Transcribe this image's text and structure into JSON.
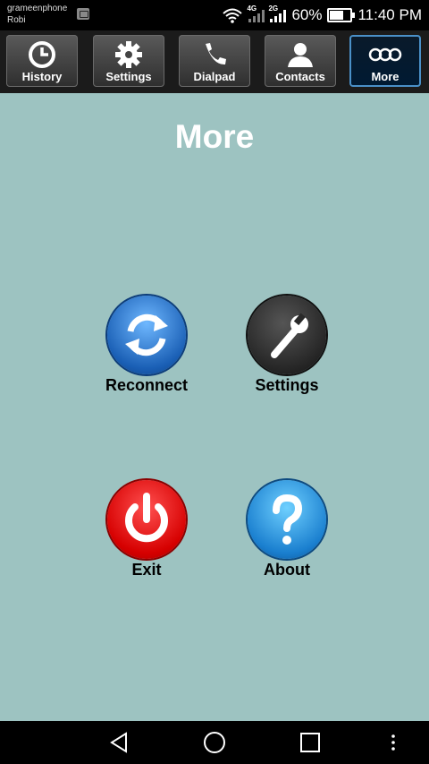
{
  "status_bar": {
    "carrier_primary": "grameenphone",
    "carrier_secondary": "Robi",
    "net1": "4G",
    "net2": "2G",
    "battery_percent": "60%",
    "battery_level": 0.6,
    "time": "11:40 PM"
  },
  "tabs": [
    {
      "label": "History",
      "icon": "clock-icon",
      "active": false
    },
    {
      "label": "Settings",
      "icon": "gear-icon",
      "active": false
    },
    {
      "label": "Dialpad",
      "icon": "phone-icon",
      "active": false
    },
    {
      "label": "Contacts",
      "icon": "person-icon",
      "active": false
    },
    {
      "label": "More",
      "icon": "dots-icon",
      "active": true
    }
  ],
  "page": {
    "title": "More"
  },
  "menu": [
    {
      "label": "Reconnect",
      "icon": "refresh-icon",
      "color": "#1a5fb5"
    },
    {
      "label": "Settings",
      "icon": "wrench-icon",
      "color": "#222222"
    },
    {
      "label": "Exit",
      "icon": "power-icon",
      "color": "#d60000"
    },
    {
      "label": "About",
      "icon": "question-icon",
      "color": "#1a7fcf"
    }
  ],
  "nav": [
    "back-icon",
    "home-icon",
    "recents-icon",
    "menu-icon"
  ]
}
